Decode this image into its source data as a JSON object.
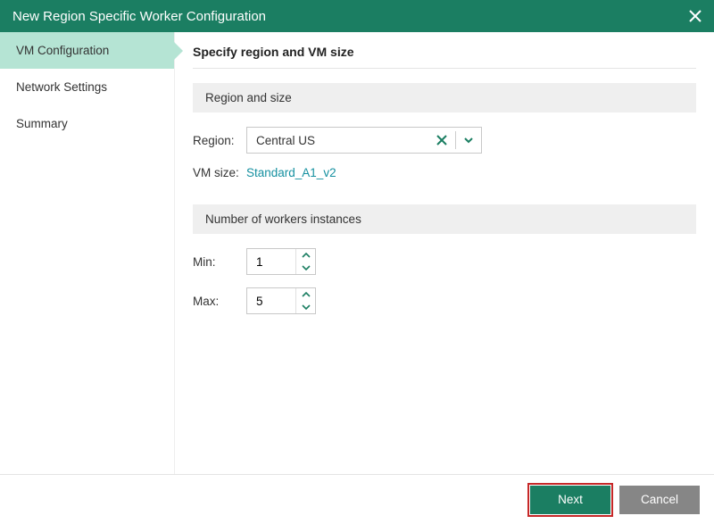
{
  "titlebar": {
    "title": "New Region Specific Worker Configuration"
  },
  "sidebar": {
    "steps": [
      {
        "label": "VM Configuration"
      },
      {
        "label": "Network Settings"
      },
      {
        "label": "Summary"
      }
    ]
  },
  "main": {
    "heading": "Specify region and VM size",
    "section_region": "Region and size",
    "region_label": "Region:",
    "region_value": "Central US",
    "vmsize_label": "VM size:",
    "vmsize_value": "Standard_A1_v2",
    "section_workers": "Number of workers instances",
    "min_label": "Min:",
    "min_value": "1",
    "max_label": "Max:",
    "max_value": "5"
  },
  "footer": {
    "next": "Next",
    "cancel": "Cancel"
  },
  "colors": {
    "brand": "#1b7e62",
    "link": "#1590a0"
  }
}
